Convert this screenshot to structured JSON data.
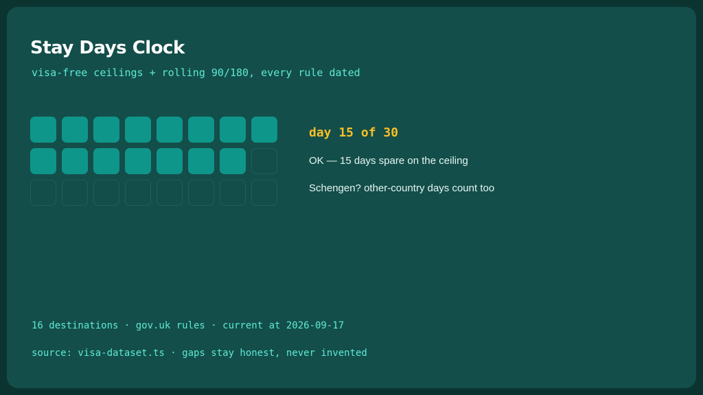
{
  "header": {
    "title": "Stay Days Clock",
    "subtitle": "visa-free ceilings + rolling 90/180, every rule dated"
  },
  "tracker": {
    "days_used": 15,
    "days_allowed": 30,
    "grid_columns": 8,
    "day_label": "day 15 of 30",
    "status_text": "OK — 15 days spare on the ceiling",
    "note_text": "Schengen? other-country days count too"
  },
  "footer": {
    "info_line": "16 destinations · gov.uk rules · current at 2026-09-17",
    "source_line": "source: visa-dataset.ts · gaps stay honest, never invented"
  },
  "colors": {
    "background": "#0b3431",
    "card": "#134e4a",
    "filled_cell": "#0f968a",
    "empty_cell_border": "#1e5f59",
    "accent_teal": "#5eead4",
    "accent_amber": "#fbbf24",
    "text": "#e6f5f2"
  }
}
